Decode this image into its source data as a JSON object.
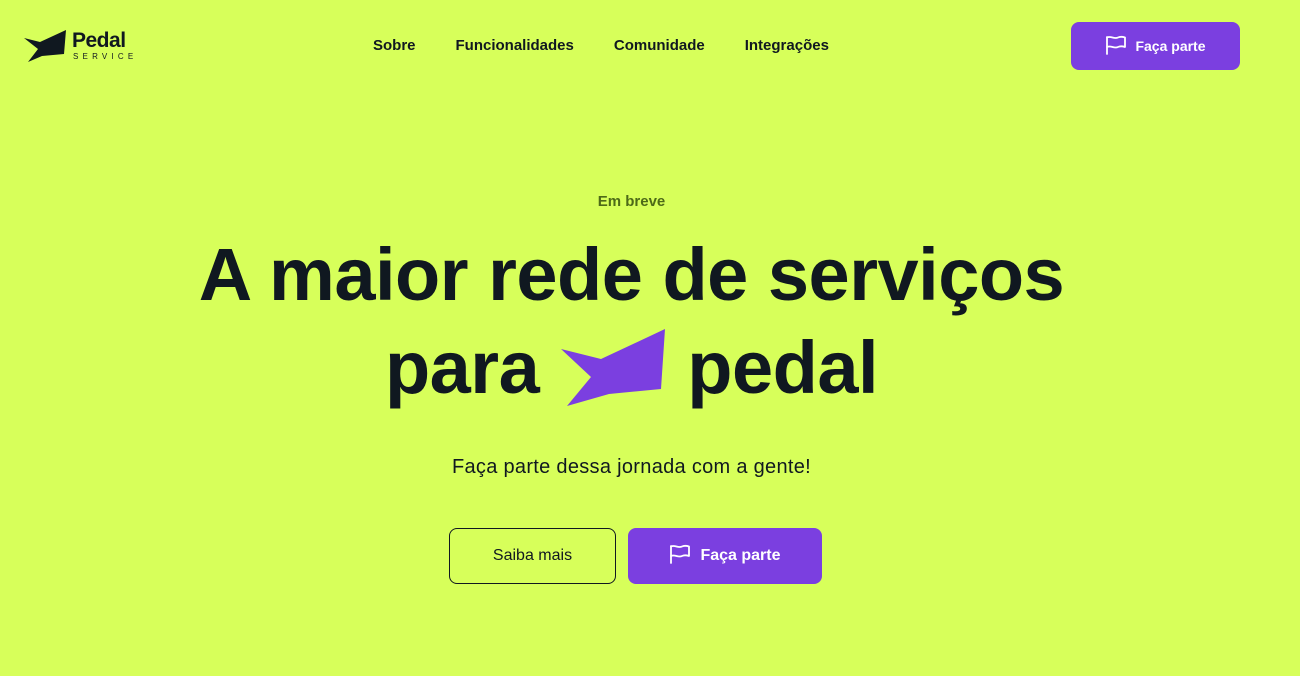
{
  "brand": {
    "name": "Pedal",
    "tagline": "SERVICE",
    "colors": {
      "background": "#d7ff5a",
      "primary": "#7b3fe0",
      "text": "#101820"
    },
    "logo_icon": "ribbon-arrow-icon"
  },
  "nav": {
    "items": [
      {
        "label": "Sobre"
      },
      {
        "label": "Funcionalidades"
      },
      {
        "label": "Comunidade"
      },
      {
        "label": "Integrações"
      }
    ]
  },
  "header": {
    "cta_label": "Faça parte",
    "cta_icon": "flag-icon"
  },
  "hero": {
    "eyebrow": "Em breve",
    "headline_line1": "A maior rede de serviços",
    "headline_line2_before": "para",
    "headline_line2_after": "pedal",
    "headline_icon": "ribbon-arrow-icon",
    "subtitle": "Faça parte dessa jornada com a gente!",
    "secondary_label": "Saiba mais",
    "primary_label": "Faça parte",
    "primary_icon": "flag-icon"
  }
}
